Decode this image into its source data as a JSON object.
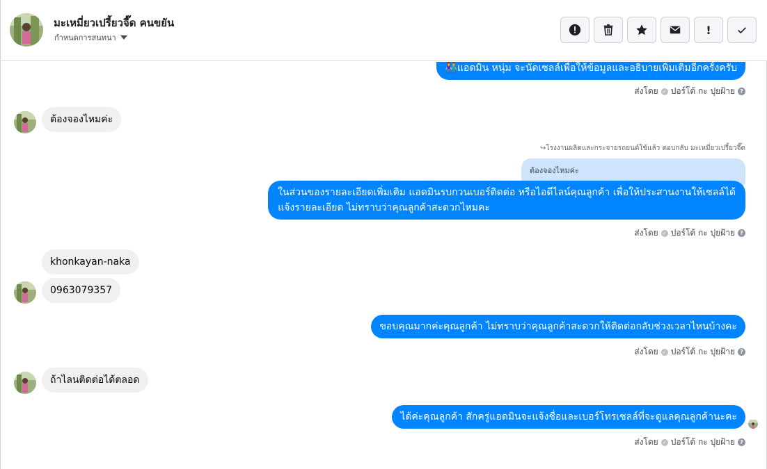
{
  "header": {
    "contact_name": "มะเหมี่ยวเปรี้ยวจี๊ด คนขยัน",
    "subtitle": "กำหนดการสนทนา"
  },
  "actions": [
    {
      "name": "report-button",
      "icon": "alert-circle-icon"
    },
    {
      "name": "delete-button",
      "icon": "trash-icon"
    },
    {
      "name": "star-button",
      "icon": "star-icon"
    },
    {
      "name": "mark-unread-button",
      "icon": "envelope-icon"
    },
    {
      "name": "important-button",
      "icon": "exclamation-icon",
      "glyph": "!"
    },
    {
      "name": "done-button",
      "icon": "check-icon"
    }
  ],
  "messages": {
    "m1_text": "👫แอดมิน หนุ่ม จะนัดเซลล์เพื่อให้ข้อมูลและอธิบายเพิ่มเติมอีกครั้งครับ",
    "m2_text": "ต้องจองไหมค่ะ",
    "reply_note": "↪โรงงานผลิตและกระจายรถยนต์ใช้แล้ว ตอบกลับ มะเหมี่ยวเปรี้ยวจี๊ด",
    "quote_text": "ต้องจองไหมค่ะ",
    "m3_line1": "ในส่วนของรายละเอียดเพิ่มเติม แอดมินรบกวนเบอร์ติดต่อ หรือไอดีไลน์คุณลูกค้า เพื่อให้ประสานงานให้เซลล์ได้",
    "m3_line2": "แจ้งรายละเอียด ไม่ทราบว่าคุณลูกค้าสะดวกไหมคะ",
    "m4_text": "khonkayan-naka",
    "m5_text": "0963079357",
    "m6_text": "ขอบคุณมากค่ะคุณลูกค้า ไม่ทราบว่าคุณลูกค้าสะดวกให้ติดต่อกลับช่วงเวลาไหนบ้างคะ",
    "m7_text": "ถ้าไลนติดต่อได้ตลอด",
    "m8_text": "ได้ค่ะคุณลูกค้า สักครู่แอดมินจะแจ้งชื่อและเบอร์โทรเซลล์ที่จะดูแลคุณลูกค้านะคะ"
  },
  "sent_by": {
    "label": "ส่งโดย",
    "sender": "ปอร์โต้ กะ ปุยฝ้าย",
    "help": "?"
  },
  "colors": {
    "outgoing_bubble": "#0084ff",
    "incoming_bubble": "#f0f0f0",
    "quote_bubble": "#cfe3fc"
  }
}
